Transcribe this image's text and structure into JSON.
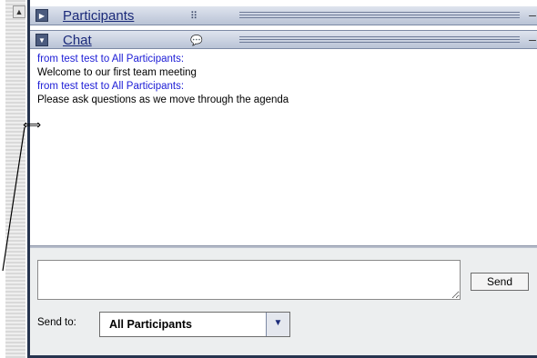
{
  "pods": {
    "participants": {
      "title": "Participants",
      "icon": "participants-grid-icon",
      "toggle": "collapsed"
    },
    "chat": {
      "title": "Chat",
      "icon": "speech-bubble-icon",
      "toggle": "expanded"
    }
  },
  "chat": {
    "messages": [
      {
        "from": "from test test to All Participants:",
        "text": "Welcome to our first team meeting"
      },
      {
        "from": "from test test to All Participants:",
        "text": "Please ask questions as we move through the agenda"
      }
    ],
    "input_value": "",
    "send_label": "Send",
    "send_to_label": "Send to:",
    "send_to_value": "All Participants"
  },
  "colors": {
    "sender": "#1c1cd6",
    "frame": "#26344f",
    "header": "#b9c3d6"
  }
}
